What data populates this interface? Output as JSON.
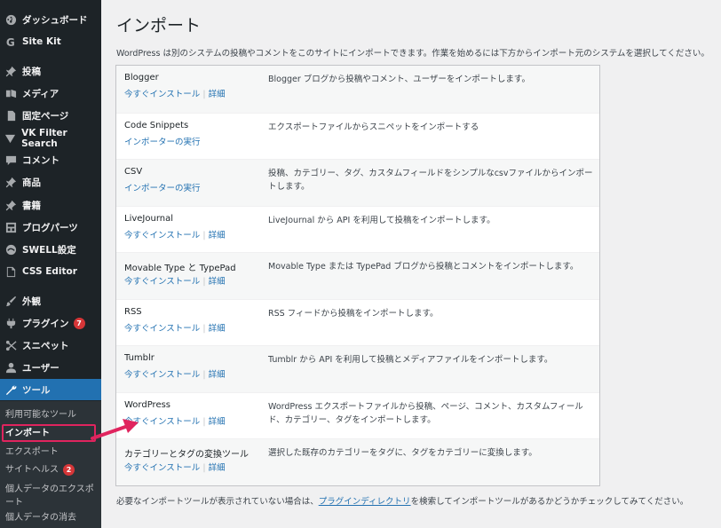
{
  "sidebar": {
    "items": [
      {
        "label": "ダッシュボード",
        "icon": "dashboard-icon"
      },
      {
        "label": "Site Kit",
        "icon": "sitekit-icon"
      },
      {
        "label": "投稿",
        "icon": "pin-icon"
      },
      {
        "label": "メディア",
        "icon": "media-icon"
      },
      {
        "label": "固定ページ",
        "icon": "page-icon"
      },
      {
        "label": "VK Filter Search",
        "icon": "filter-icon"
      },
      {
        "label": "コメント",
        "icon": "comment-icon"
      },
      {
        "label": "商品",
        "icon": "pin-icon"
      },
      {
        "label": "書籍",
        "icon": "pin-icon"
      },
      {
        "label": "ブログパーツ",
        "icon": "blogparts-icon"
      },
      {
        "label": "SWELL設定",
        "icon": "swell-icon"
      },
      {
        "label": "CSS Editor",
        "icon": "css-editor-icon"
      },
      {
        "label": "外観",
        "icon": "brush-icon"
      },
      {
        "label": "プラグイン",
        "icon": "plugin-icon",
        "badge": "7"
      },
      {
        "label": "スニペット",
        "icon": "snippet-icon"
      },
      {
        "label": "ユーザー",
        "icon": "user-icon"
      },
      {
        "label": "ツール",
        "icon": "wrench-icon"
      }
    ],
    "submenu": [
      {
        "label": "利用可能なツール"
      },
      {
        "label": "インポート"
      },
      {
        "label": "エクスポート"
      },
      {
        "label": "サイトヘルス",
        "badge": "2"
      },
      {
        "label": "個人データのエクスポート"
      },
      {
        "label": "個人データの消去"
      }
    ]
  },
  "main": {
    "title": "インポート",
    "intro": "WordPress は別のシステムの投稿やコメントをこのサイトにインポートできます。作業を始めるには下方からインポート元のシステムを選択してください。",
    "link_separator": " | ",
    "importers": [
      {
        "name": "Blogger",
        "link1": "今すぐインストール",
        "link2": "詳細",
        "desc": "Blogger ブログから投稿やコメント、ユーザーをインポートします。"
      },
      {
        "name": "Code Snippets",
        "link1": "インポーターの実行",
        "link2": "",
        "desc": "エクスポートファイルからスニペットをインポートする"
      },
      {
        "name": "CSV",
        "link1": "インポーターの実行",
        "link2": "",
        "desc": "投稿、カテゴリー、タグ、カスタムフィールドをシンプルなcsvファイルからインポートします。"
      },
      {
        "name": "LiveJournal",
        "link1": "今すぐインストール",
        "link2": "詳細",
        "desc": "LiveJournal から API を利用して投稿をインポートします。"
      },
      {
        "name": "Movable Type と TypePad",
        "link1": "今すぐインストール",
        "link2": "詳細",
        "desc": "Movable Type または TypePad ブログから投稿とコメントをインポートします。"
      },
      {
        "name": "RSS",
        "link1": "今すぐインストール",
        "link2": "詳細",
        "desc": "RSS フィードから投稿をインポートします。"
      },
      {
        "name": "Tumblr",
        "link1": "今すぐインストール",
        "link2": "詳細",
        "desc": "Tumblr から API を利用して投稿とメディアファイルをインポートします。"
      },
      {
        "name": "WordPress",
        "link1": "今すぐインストール",
        "link2": "詳細",
        "desc": "WordPress エクスポートファイルから投稿、ページ、コメント、カスタムフィールド、カテゴリー、タグをインポートします。"
      },
      {
        "name": "カテゴリーとタグの変換ツール",
        "link1": "今すぐインストール",
        "link2": "詳細",
        "desc": "選択した既存のカテゴリーをタグに、タグをカテゴリーに変換します。"
      }
    ],
    "footer_before": "必要なインポートツールが表示されていない場合は、",
    "footer_link": "プラグインディレクトリ",
    "footer_after": "を検索してインポートツールがあるかどうかチェックしてみてください。"
  },
  "colors": {
    "sidebar_bg": "#1d2327",
    "active": "#2271b1",
    "link": "#2271b1",
    "badge": "#d63638",
    "highlight": "#e0245e"
  }
}
